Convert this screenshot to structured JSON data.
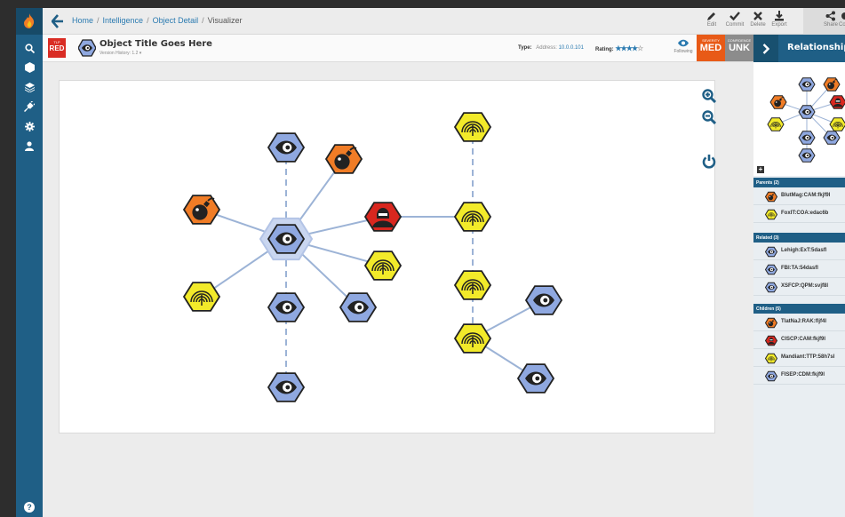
{
  "breadcrumb": {
    "home": "Home",
    "intelligence": "Intelligence",
    "object_detail": "Object Detail",
    "current": "Visualizer"
  },
  "toolbar": {
    "edit": "Edit",
    "commit": "Commit",
    "delete": "Delete",
    "export": "Export",
    "share": "Share",
    "share_partial": "Co"
  },
  "object": {
    "tlp_label": "TLP",
    "tlp_value": "RED",
    "title": "Object Title Goes Here",
    "version": "Version History: 1.2 ▾",
    "type_label": "Type:",
    "type_kind": "Address:",
    "type_value": "10.0.0.101",
    "rating_label": "Rating:",
    "rating_value": 3.5,
    "rating_max": 5,
    "following": "Following",
    "severity_label": "SEVERITY",
    "severity_value": "MED",
    "confidence_label": "CONFIDENCE",
    "confidence_value": "UNK"
  },
  "panel": {
    "title": "Relationships",
    "parents_header": "Parents (2)",
    "parents": [
      {
        "label": "BlutMag:CAM:fkjf9l",
        "icon": "bomb-icon"
      },
      {
        "label": "FoxIT:COA:edac6b",
        "icon": "fingerprint-icon"
      }
    ],
    "related_header": "Related (3)",
    "related": [
      {
        "label": "Lehigh:ExT:5dasfl",
        "icon": "eye-icon"
      },
      {
        "label": "FBI:TA:54dasfl",
        "icon": "eye-icon"
      },
      {
        "label": "XSFCP:QPM:svjf8l",
        "icon": "eye-icon"
      }
    ],
    "children_header": "Children (5)",
    "children": [
      {
        "label": "TlatNaJ:RAK:fljf4l",
        "icon": "bomb-icon"
      },
      {
        "label": "CISCP:CAM:fkjf9l",
        "icon": "hacker-icon"
      },
      {
        "label": "Mandiant:TTP:58h7sl",
        "icon": "fingerprint-icon"
      },
      {
        "label": "FISEP:CDM:fkjf9l",
        "icon": "eye-icon"
      }
    ]
  },
  "colors": {
    "nav": "#1f5f86",
    "eye_node": "#8fa8e0",
    "bomb_node": "#f07c26",
    "fingerprint_node": "#f2ea2a",
    "hacker_node": "#d9271f",
    "edge": "#9cb3d6",
    "severity": "#e85a17",
    "confidence": "#8c8c8c",
    "tlp": "#d92c24"
  }
}
